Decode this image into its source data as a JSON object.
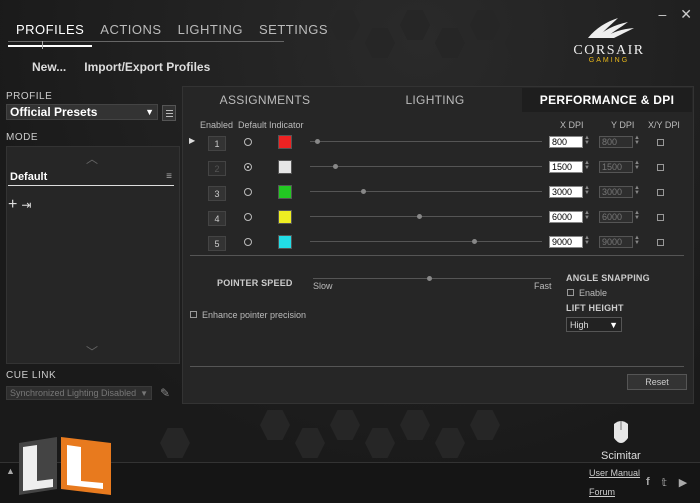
{
  "top_tabs": [
    "PROFILES",
    "ACTIONS",
    "LIGHTING",
    "SETTINGS"
  ],
  "sub_actions": {
    "new": "New...",
    "import_export": "Import/Export Profiles"
  },
  "brand": {
    "name": "CORSAIR",
    "tag": "GAMING"
  },
  "profile": {
    "label": "PROFILE",
    "selected": "Official Presets"
  },
  "mode": {
    "label": "MODE",
    "item": "Default"
  },
  "cue_link": {
    "label": "CUE LINK",
    "selected": "Synchronized Lighting Disabled"
  },
  "panel_tabs": [
    "ASSIGNMENTS",
    "LIGHTING",
    "PERFORMANCE & DPI"
  ],
  "columns": {
    "enabled": "Enabled",
    "default": "Default",
    "indicator": "Indicator",
    "x_dpi": "X DPI",
    "y_dpi": "Y DPI",
    "xy_dpi": "X/Y DPI"
  },
  "dpi_rows": [
    {
      "num": "1",
      "x": "800",
      "y": "800",
      "color": "#ee2222",
      "slider": 0.02,
      "default": false
    },
    {
      "num": "2",
      "x": "1500",
      "y": "1500",
      "color": "#e6e6e6",
      "slider": 0.1,
      "default": true
    },
    {
      "num": "3",
      "x": "3000",
      "y": "3000",
      "color": "#22c822",
      "slider": 0.22,
      "default": false
    },
    {
      "num": "4",
      "x": "6000",
      "y": "6000",
      "color": "#eeee22",
      "slider": 0.46,
      "default": false
    },
    {
      "num": "5",
      "x": "9000",
      "y": "9000",
      "color": "#22dde6",
      "slider": 0.7,
      "default": false
    }
  ],
  "pointer": {
    "label": "POINTER SPEED",
    "slow": "Slow",
    "fast": "Fast",
    "value": 0.48,
    "enhance": "Enhance pointer precision"
  },
  "angle": {
    "label": "ANGLE SNAPPING",
    "enable": "Enable"
  },
  "lift": {
    "label": "LIFT HEIGHT",
    "selected": "High"
  },
  "reset": "Reset",
  "device": "Scimitar",
  "links": {
    "manual": "User Manual",
    "forum": "Forum"
  },
  "window_controls": {
    "minimize": "–",
    "close": "✕"
  }
}
